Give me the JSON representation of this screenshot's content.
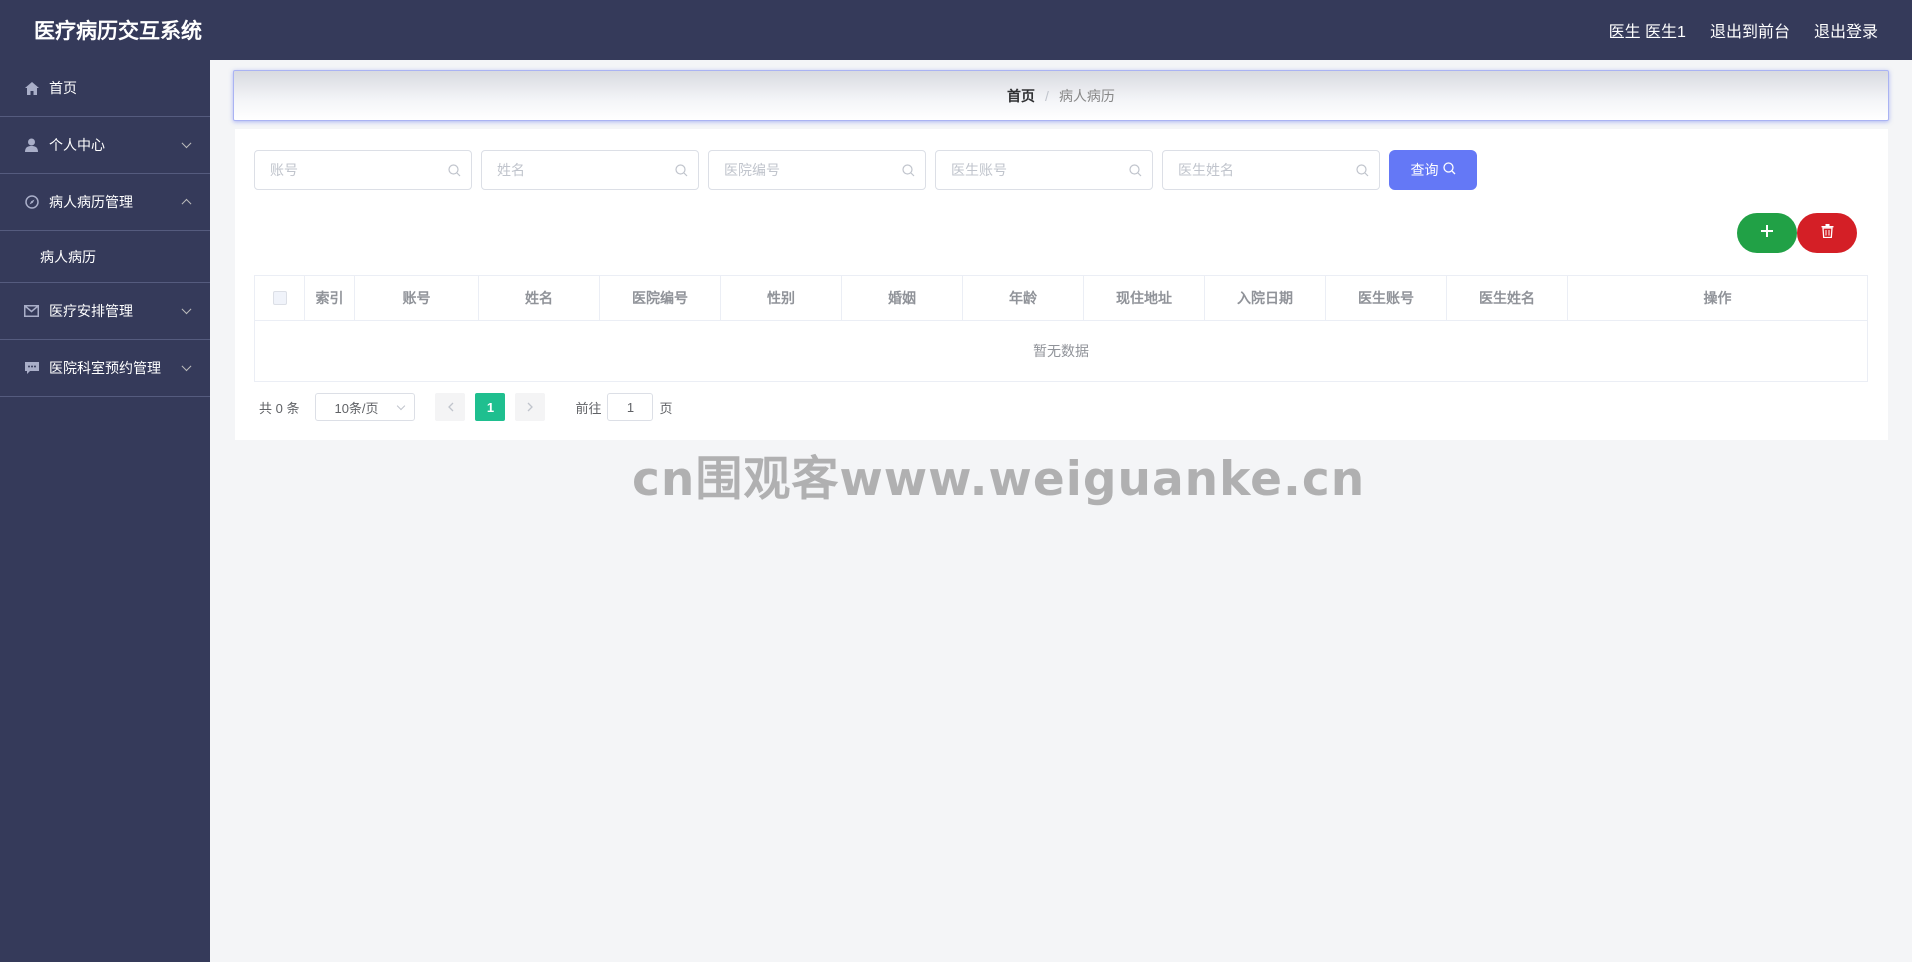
{
  "app": {
    "title": "医疗病历交互系统"
  },
  "header": {
    "user_label": "医生 医生1",
    "back_to_front": "退出到前台",
    "logout": "退出登录"
  },
  "sidebar": {
    "items": [
      {
        "label": "首页",
        "icon": "home-icon"
      },
      {
        "label": "个人中心",
        "icon": "user-icon"
      },
      {
        "label": "病人病历管理",
        "icon": "compass-icon",
        "expanded": true,
        "children": [
          {
            "label": "病人病历"
          }
        ]
      },
      {
        "label": "医疗安排管理",
        "icon": "mail-icon"
      },
      {
        "label": "医院科室预约管理",
        "icon": "chat-icon"
      }
    ]
  },
  "breadcrumb": {
    "home": "首页",
    "separator": "/",
    "current": "病人病历"
  },
  "search": {
    "fields": [
      {
        "placeholder": "账号",
        "value": ""
      },
      {
        "placeholder": "姓名",
        "value": ""
      },
      {
        "placeholder": "医院编号",
        "value": ""
      },
      {
        "placeholder": "医生账号",
        "value": ""
      },
      {
        "placeholder": "医生姓名",
        "value": ""
      }
    ],
    "query_label": "查询"
  },
  "actions": {
    "add_icon": "plus-icon",
    "delete_icon": "trash-icon"
  },
  "table": {
    "columns": [
      "索引",
      "账号",
      "姓名",
      "医院编号",
      "性别",
      "婚姻",
      "年龄",
      "现住地址",
      "入院日期",
      "医生账号",
      "医生姓名",
      "操作"
    ],
    "empty_text": "暂无数据"
  },
  "pagination": {
    "total_text": "共 0 条",
    "page_size": "10条/页",
    "current_page": "1",
    "jump_prefix": "前往",
    "jump_value": "1",
    "jump_suffix": "页"
  },
  "watermark": "cn围观客www.weiguanke.cn",
  "colors": {
    "nav_bg": "#353a5a",
    "primary": "#6478f6",
    "success": "#21a146",
    "danger": "#d41f26",
    "page_active": "#1fbf8f"
  }
}
